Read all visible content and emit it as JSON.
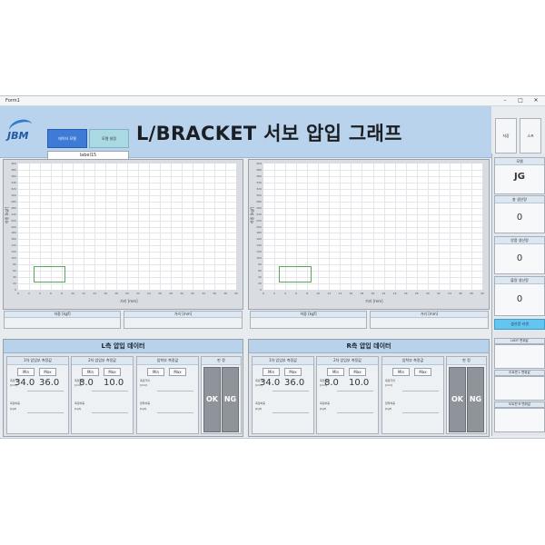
{
  "window": {
    "title": "Form1"
  },
  "header": {
    "logo": "JBM",
    "btn_primary": "데이터 모델",
    "btn_secondary": "모델 설정",
    "label": "label15",
    "title": "L/BRACKET 서보 압입 그래프",
    "right_buttons": [
      "저장",
      "소프"
    ]
  },
  "charts": [
    {
      "ylabel": "하중 [kgf]",
      "xlabel": "거리 [mm]",
      "yticks": [
        "400",
        "380",
        "360",
        "340",
        "320",
        "300",
        "280",
        "260",
        "240",
        "220",
        "200",
        "180",
        "160",
        "140",
        "120",
        "100",
        "80",
        "60",
        "40",
        "20",
        "0"
      ],
      "xticks": [
        "0",
        "2",
        "4",
        "6",
        "8",
        "10",
        "12",
        "14",
        "16",
        "18",
        "20",
        "22",
        "24",
        "26",
        "28",
        "30",
        "32",
        "34",
        "36",
        "38",
        "40"
      ],
      "readouts": [
        "하중 [kgf]",
        "거리 [mm]"
      ]
    },
    {
      "ylabel": "하중 [kgf]",
      "xlabel": "거리 [mm]",
      "yticks": [
        "400",
        "380",
        "360",
        "340",
        "320",
        "300",
        "280",
        "260",
        "240",
        "220",
        "200",
        "180",
        "160",
        "140",
        "120",
        "100",
        "80",
        "60",
        "40",
        "20",
        "0"
      ],
      "xticks": [
        "0",
        "2",
        "4",
        "6",
        "8",
        "10",
        "12",
        "14",
        "16",
        "18",
        "20",
        "22",
        "24",
        "26",
        "28",
        "30",
        "32",
        "34",
        "36",
        "38",
        "40"
      ],
      "readouts": [
        "하중 [kgf]",
        "거리 [mm]"
      ]
    }
  ],
  "chart_data": [
    {
      "type": "line",
      "title": "",
      "xlabel": "거리 [mm]",
      "ylabel": "하중 [kgf]",
      "xlim": [
        0,
        40
      ],
      "ylim": [
        0,
        400
      ],
      "series": [],
      "grid": true
    },
    {
      "type": "line",
      "title": "",
      "xlabel": "거리 [mm]",
      "ylabel": "하중 [kgf]",
      "xlim": [
        0,
        40
      ],
      "ylim": [
        0,
        400
      ],
      "series": [],
      "grid": true
    }
  ],
  "sections": [
    {
      "title": "L측 압입 데이터",
      "subs": [
        {
          "head": "1차 압입부 측정값",
          "min_label": "Min",
          "max_label": "Max",
          "min": "34.0",
          "max": "36.0",
          "l1": "측정거리",
          "l2": "[mm]",
          "l3": "측정하중",
          "l4": "[kgf]"
        },
        {
          "head": "2차 압입부 측정값",
          "min_label": "Min",
          "max_label": "Max",
          "min": "8.0",
          "max": "10.0",
          "l1": "측정거리",
          "l2": "[mm]",
          "l3": "측정하중",
          "l4": "[kgf]"
        },
        {
          "head": "압착부 측정값",
          "min_label": "Min",
          "max_label": "Max",
          "min": "",
          "max": "",
          "l1": "측정거리",
          "l2": "[mm]",
          "l3": "압착하중",
          "l4": "[kgf]"
        }
      ],
      "judge_head": "판 정",
      "ok": "OK",
      "ng": "NG"
    },
    {
      "title": "R측 압입 데이터",
      "subs": [
        {
          "head": "1차 압입부 측정값",
          "min_label": "Min",
          "max_label": "Max",
          "min": "34.0",
          "max": "36.0",
          "l1": "측정거리",
          "l2": "[mm]",
          "l3": "측정하중",
          "l4": "[kgf]"
        },
        {
          "head": "2차 압입부 측정값",
          "min_label": "Min",
          "max_label": "Max",
          "min": "8.0",
          "max": "10.0",
          "l1": "측정거리",
          "l2": "[mm]",
          "l3": "측정하중",
          "l4": "[kgf]"
        },
        {
          "head": "압착부 측정값",
          "min_label": "Min",
          "max_label": "Max",
          "min": "",
          "max": "",
          "l1": "측정거리",
          "l2": "[mm]",
          "l3": "압착하중",
          "l4": "[kgf]"
        }
      ],
      "judge_head": "판 정",
      "ok": "OK",
      "ng": "NG"
    }
  ],
  "sidebar": {
    "model_label": "모델",
    "model_value": "JG",
    "total_label": "총 생산량",
    "total_value": "0",
    "good_label": "양품 생산량",
    "good_value": "0",
    "bad_label": "불량 생산량",
    "bad_value": "0",
    "reset_label": "생산량 리셋",
    "stack_labels": [
      "LVDT 변위값",
      "도트핀 L 변위값",
      "도트핀 R 변위값"
    ]
  },
  "colors": {
    "header": "#b9d3ec",
    "primary_button": "#3d7bd6",
    "judge": "#8f949a",
    "reset": "#64c6f0"
  }
}
